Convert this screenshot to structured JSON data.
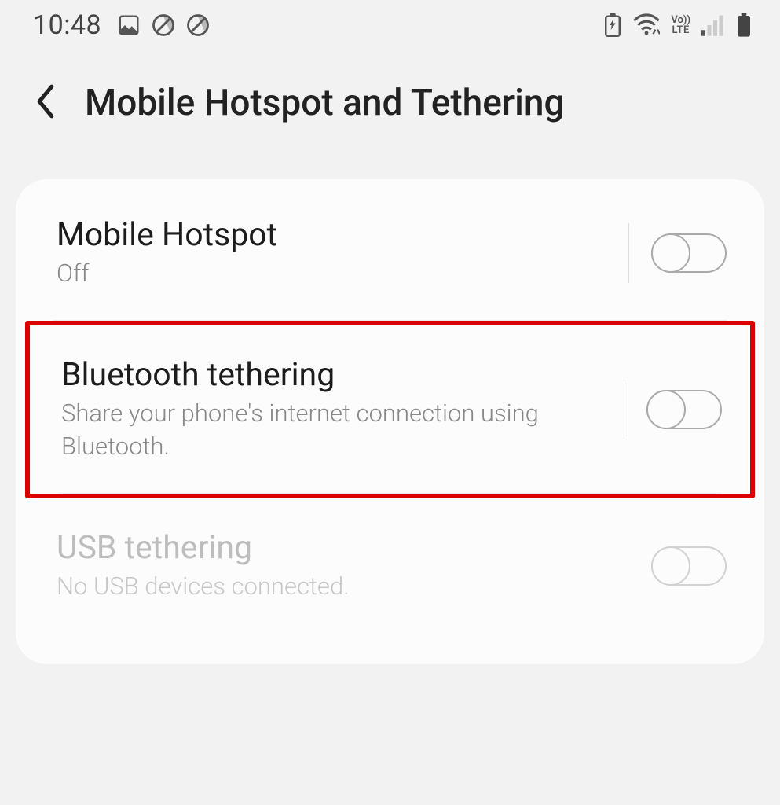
{
  "statusbar": {
    "time": "10:48"
  },
  "header": {
    "title": "Mobile Hotspot and Tethering"
  },
  "settings": {
    "mobile_hotspot": {
      "title": "Mobile Hotspot",
      "subtitle": "Off",
      "on": false
    },
    "bluetooth_tethering": {
      "title": "Bluetooth tethering",
      "subtitle": "Share your phone's internet connection using Bluetooth.",
      "on": false
    },
    "usb_tethering": {
      "title": "USB tethering",
      "subtitle": "No USB devices connected.",
      "on": false,
      "disabled": true
    }
  }
}
